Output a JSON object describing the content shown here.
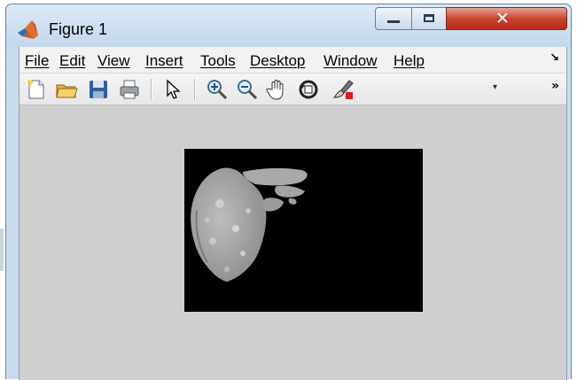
{
  "window": {
    "title": "Figure 1",
    "controls": {
      "minimize": "minimize-button",
      "maximize": "maximize-button",
      "close": "close-button"
    }
  },
  "menu": {
    "items": [
      {
        "label": "File"
      },
      {
        "label": "Edit"
      },
      {
        "label": "View"
      },
      {
        "label": "Insert"
      },
      {
        "label": "Tools"
      },
      {
        "label": "Desktop"
      },
      {
        "label": "Window"
      },
      {
        "label": "Help"
      }
    ],
    "overflow": "↘"
  },
  "toolbar": {
    "tools": [
      "new-figure-icon",
      "open-file-icon",
      "save-icon",
      "print-icon",
      "edit-plot-arrow-icon",
      "zoom-in-icon",
      "zoom-out-icon",
      "pan-hand-icon",
      "rotate-3d-icon",
      "data-cursor-brush-icon"
    ],
    "dropdown": "▾",
    "overflow": "»"
  },
  "figure": {
    "image": "grayscale-organ-segmentation",
    "background": "#000000",
    "canvas_color": "#cfcfcf"
  },
  "colors": {
    "titlebar": "#c9dcee",
    "close": "#c8452f",
    "menubar": "#f2f2f2"
  }
}
